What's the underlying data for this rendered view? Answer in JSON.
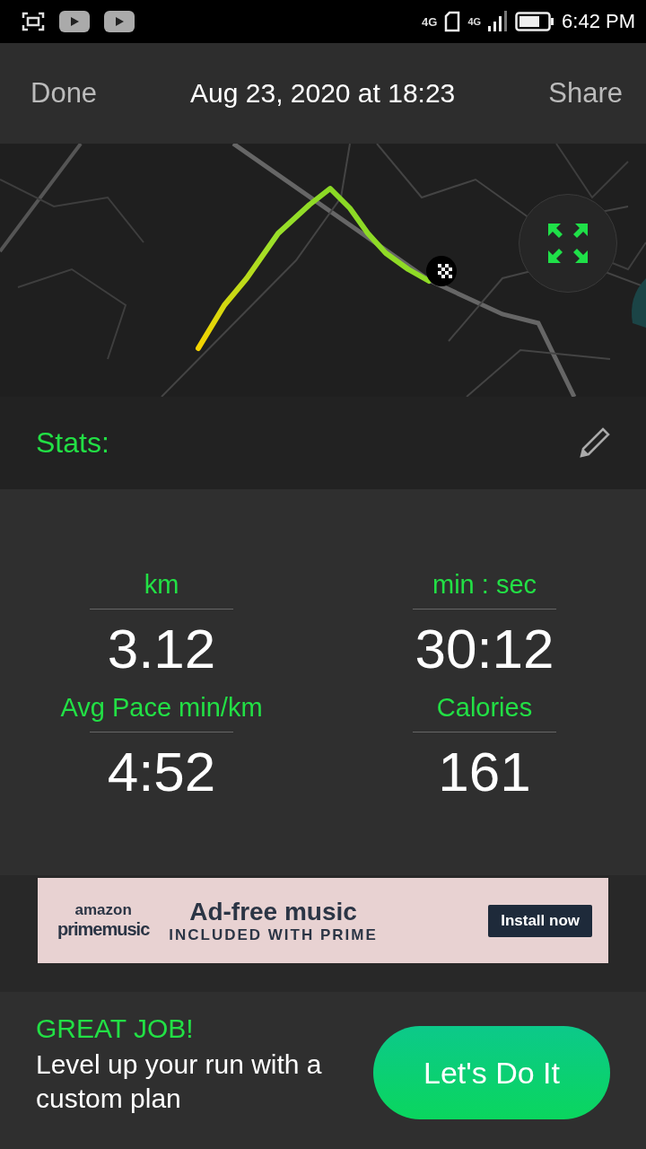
{
  "status_bar": {
    "network_labels": [
      "4G",
      "4G"
    ],
    "time": "6:42 PM"
  },
  "header": {
    "done": "Done",
    "title": "Aug 23, 2020 at 18:23",
    "share": "Share"
  },
  "stats": {
    "title": "Stats:",
    "items": [
      {
        "label": "km",
        "value": "3.12"
      },
      {
        "label": "min : sec",
        "value": "30:12"
      },
      {
        "label": "Avg Pace min/km",
        "value": "4:52"
      },
      {
        "label": "Calories",
        "value": "161"
      }
    ]
  },
  "ad": {
    "brand_top": "amazon",
    "brand_bottom": "primemusic",
    "headline": "Ad-free music",
    "subline": "INCLUDED WITH PRIME",
    "button": "Install now"
  },
  "promo": {
    "headline": "GREAT JOB!",
    "text": "Level up your run with a custom plan",
    "button": "Let's Do It"
  }
}
